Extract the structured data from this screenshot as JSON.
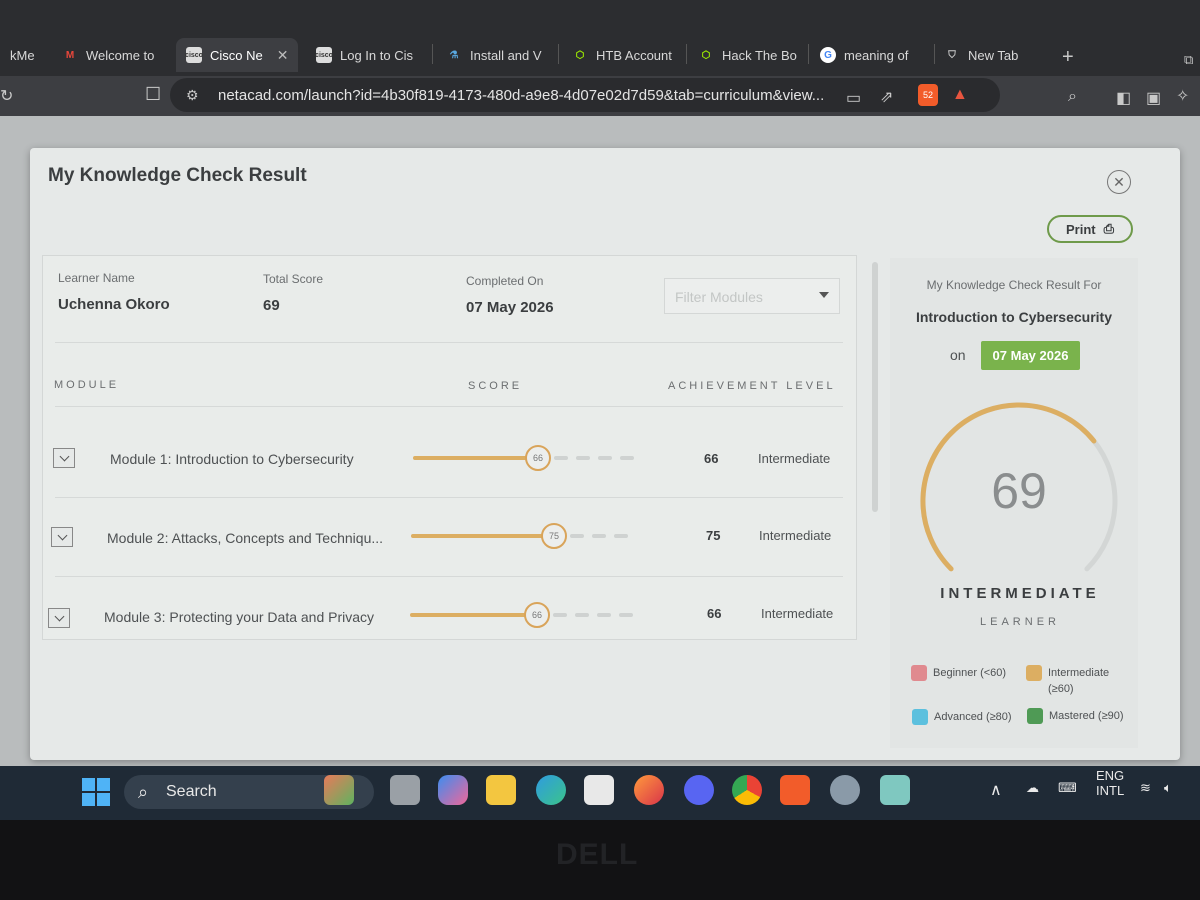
{
  "browser": {
    "tabs": [
      {
        "label": "kMe"
      },
      {
        "label": "Welcome to"
      },
      {
        "label": "Cisco Ne"
      },
      {
        "label": "Log In to Cis"
      },
      {
        "label": "Install and V"
      },
      {
        "label": "HTB Account"
      },
      {
        "label": "Hack The Bo"
      },
      {
        "label": "meaning of"
      },
      {
        "label": "New Tab"
      }
    ],
    "url": "netacad.com/launch?id=4b30f819-4173-480d-a9e8-4d07e02d7d59&tab=curriculum&view...",
    "shield_count": "52"
  },
  "modal": {
    "title": "My Knowledge Check Result",
    "print_label": "Print",
    "learner_name_label": "Learner Name",
    "learner_name": "Uchenna Okoro",
    "total_score_label": "Total Score",
    "total_score": "69",
    "completed_on_label": "Completed On",
    "completed_on": "07 May 2026",
    "filter_placeholder": "Filter Modules",
    "columns": {
      "module": "MODULE",
      "score": "SCORE",
      "achievement": "ACHIEVEMENT LEVEL"
    },
    "modules": [
      {
        "name": "Module 1: Introduction to Cybersecurity",
        "score": "66",
        "level": "Intermediate",
        "progress": 0.66
      },
      {
        "name": "Module 2: Attacks, Concepts and Techniqu...",
        "score": "75",
        "level": "Intermediate",
        "progress": 0.75
      },
      {
        "name": "Module 3: Protecting your Data and Privacy",
        "score": "66",
        "level": "Intermediate",
        "progress": 0.66
      }
    ]
  },
  "summary": {
    "result_for_label": "My Knowledge Check Result For",
    "course": "Introduction to Cybersecurity",
    "on_label": "on",
    "date": "07 May 2026",
    "score": "69",
    "score_fraction": 0.69,
    "level": "INTERMEDIATE",
    "level_sub": "LEARNER",
    "legend": [
      {
        "label": "Beginner (<60)",
        "color": "#e08a8f"
      },
      {
        "label": "Intermediate (≥60)",
        "color": "#dcae62"
      },
      {
        "label": "Advanced (≥80)",
        "color": "#5cc0de"
      },
      {
        "label": "Mastered (≥90)",
        "color": "#4f9a55"
      }
    ]
  },
  "taskbar": {
    "search_label": "Search",
    "lang_line1": "ENG",
    "lang_line2": "INTL"
  },
  "colors": {
    "accent_bar": "#dcae62",
    "date_badge": "#7ab34c",
    "print_border": "#6e9a4a"
  }
}
